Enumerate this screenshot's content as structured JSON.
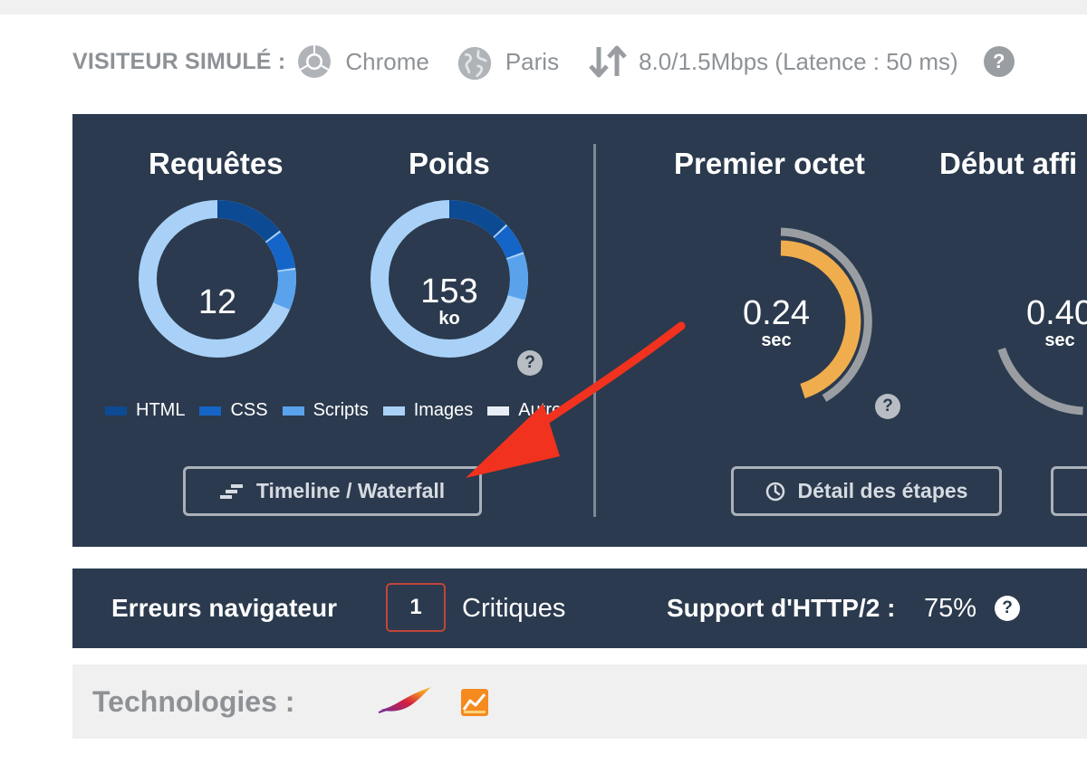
{
  "visitor": {
    "label": "VISITEUR SIMULÉ :",
    "browser": "Chrome",
    "location": "Paris",
    "connection": "8.0/1.5Mbps (Latence : 50 ms)",
    "help": "?"
  },
  "metrics": {
    "requests": {
      "title": "Requêtes",
      "value": "12"
    },
    "weight": {
      "title": "Poids",
      "value": "153",
      "unit": "ko",
      "help": "?"
    },
    "first_byte": {
      "title": "Premier octet",
      "value": "0.24",
      "unit": "sec",
      "help": "?"
    },
    "start_render": {
      "title": "Début affi",
      "value": "0.40",
      "unit": "sec"
    }
  },
  "legend": [
    {
      "label": "HTML",
      "color": "#0d4a94"
    },
    {
      "label": "CSS",
      "color": "#1565c8"
    },
    {
      "label": "Scripts",
      "color": "#5aa3ec"
    },
    {
      "label": "Images",
      "color": "#a9d1f7"
    },
    {
      "label": "Autre",
      "color": "#e8eef5"
    }
  ],
  "buttons": {
    "timeline": "Timeline / Waterfall",
    "steps": "Détail des étapes"
  },
  "errors": {
    "title": "Erreurs navigateur",
    "count": "1",
    "critical_label": "Critiques",
    "http2_label": "Support d'HTTP/2 :",
    "http2_value": "75%",
    "help": "?"
  },
  "technologies": {
    "label": "Technologies :",
    "icons": [
      "apache-feather-icon",
      "analytics-chart-icon"
    ]
  },
  "colors": {
    "panel_bg": "#2b3a4e",
    "first_byte_arc": "#f0ad4e",
    "start_render_arc": "#6cc04a",
    "error_border": "#c0453a",
    "annotation_arrow": "#f0321e"
  }
}
